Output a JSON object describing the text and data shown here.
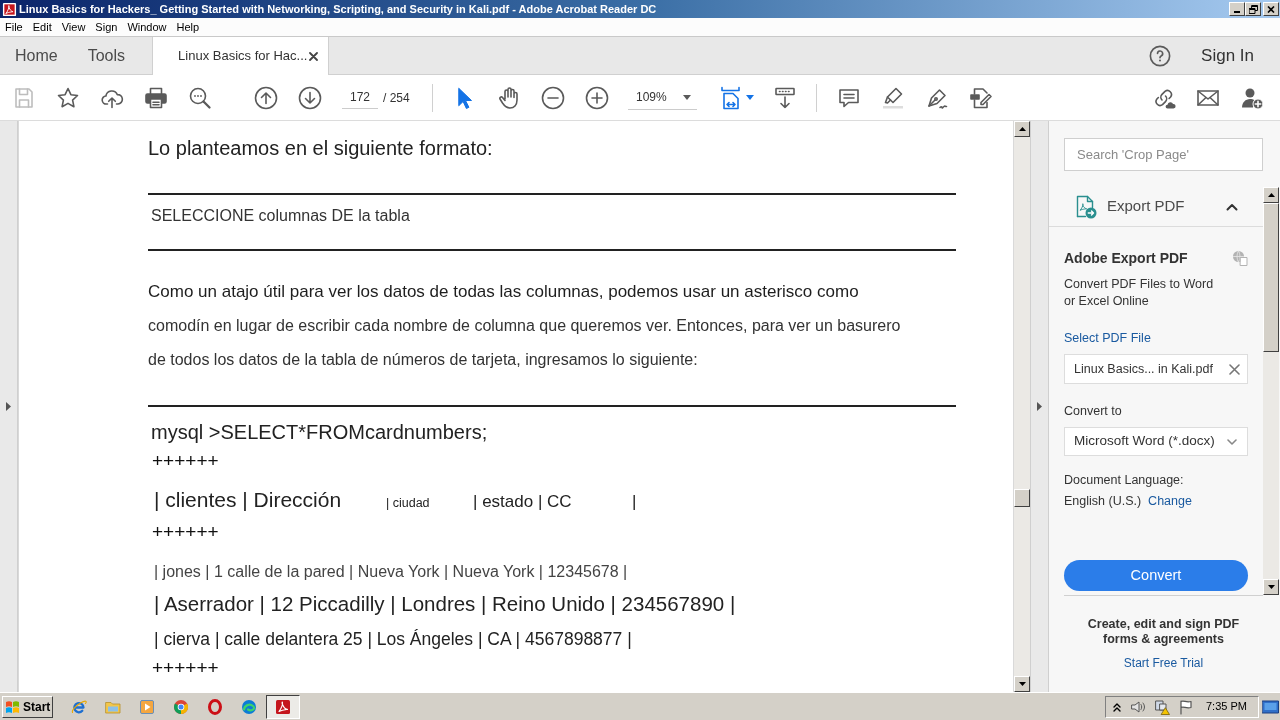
{
  "window": {
    "title": "Linux Basics for Hackers_ Getting Started with Networking, Scripting, and Security in Kali.pdf - Adobe Acrobat Reader DC"
  },
  "menu": [
    "File",
    "Edit",
    "View",
    "Sign",
    "Window",
    "Help"
  ],
  "tabs": [
    {
      "label": "Home",
      "selected": false,
      "closable": false
    },
    {
      "label": "Tools",
      "selected": false,
      "closable": false
    },
    {
      "label": "Linux Basics for Hac...",
      "selected": true,
      "closable": true
    }
  ],
  "account": {
    "sign_in": "Sign In"
  },
  "toolbar": {
    "save_disabled": true,
    "page_current": "172",
    "page_total": "/ 254",
    "pointer_tools": [
      {
        "kind": "select",
        "selected": true
      },
      {
        "kind": "hand",
        "selected": false
      }
    ],
    "zoom": "109%"
  },
  "document": {
    "heading": "Lo planteamos en el siguiente formato:",
    "syntax": "SELECCIONE columnas DE la tabla",
    "paragraph": [
      "Como un atajo útil para ver los datos de todas las columnas, podemos usar un asterisco como",
      "comodín en lugar de escribir cada nombre de columna que queremos ver. Entonces, para ver un basurero",
      "de todos los datos de la tabla de números de tarjeta, ingresamos lo siguiente:"
    ],
    "code_lines": [
      {
        "kind": "command",
        "text": "mysql >SELECT*FROMcardnumbers;"
      },
      {
        "kind": "border",
        "text": "++++++"
      },
      {
        "kind": "header",
        "segments": [
          "| clientes | Dirección",
          "| ciudad",
          "| estado | CC",
          "|"
        ]
      },
      {
        "kind": "border",
        "text": "++++++"
      },
      {
        "kind": "row",
        "text": "| jones | 1 calle de la pared | Nueva York | Nueva York | 12345678 |"
      },
      {
        "kind": "row",
        "text": "| Aserrador | 12 Piccadilly | Londres | Reino Unido | 234567890 |"
      },
      {
        "kind": "row",
        "text": "| cierva | calle delantera 25 | Los Ángeles | CA | 4567898877 |"
      },
      {
        "kind": "border",
        "text": "++++++"
      }
    ]
  },
  "side_panel": {
    "search_placeholder": "Search 'Crop Page'",
    "section": {
      "title": "Export PDF",
      "expanded": true
    },
    "heading": "Adobe Export PDF",
    "description": "Convert PDF Files to Word or Excel Online",
    "select_file_link": "Select PDF File",
    "file_name": "Linux Basics... in Kali.pdf",
    "convert_to_label": "Convert to",
    "format": "Microsoft Word (*.docx)",
    "language_label": "Document Language:",
    "language": "English (U.S.)",
    "change_link": "Change",
    "convert_button": "Convert",
    "promo": "Create, edit and sign PDF forms & agreements",
    "trial_link": "Start Free Trial"
  },
  "taskbar": {
    "start": "Start",
    "apps": [
      {
        "kind": "ie",
        "selected": false
      },
      {
        "kind": "folder",
        "selected": false
      },
      {
        "kind": "media",
        "selected": false
      },
      {
        "kind": "chrome",
        "selected": false
      },
      {
        "kind": "opera",
        "selected": false
      },
      {
        "kind": "edge",
        "selected": false
      },
      {
        "kind": "acrobat",
        "selected": true
      }
    ],
    "clock": "7:35 PM"
  }
}
